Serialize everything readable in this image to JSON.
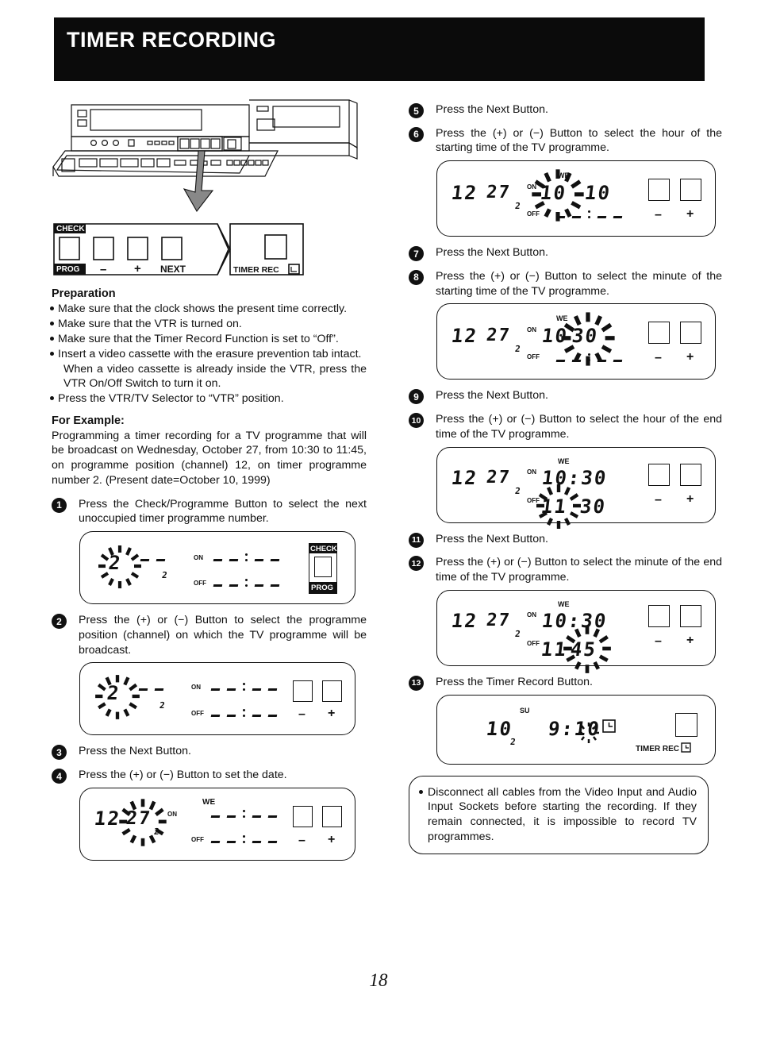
{
  "header": {
    "title": "TIMER RECORDING"
  },
  "page_number": "18",
  "illustration": {
    "name": "vtr-front-panel-drawing",
    "callout": {
      "check_label": "CHECK",
      "prog_label": "PROG",
      "minus_label": "–",
      "plus_label": "+",
      "next_label": "NEXT",
      "timer_rec_label": "TIMER REC"
    }
  },
  "preparation": {
    "heading": "Preparation",
    "items": [
      "Make sure that the clock shows the present time correctly.",
      "Make sure that the VTR is turned on.",
      "Make sure that the Timer Record Function is set to “Off”.",
      "Insert a video cassette with the erasure prevention tab intact.",
      "Press the VTR/TV Selector to “VTR” position."
    ],
    "continuation": "When a video cassette is already inside the VTR, press the VTR On/Off Switch to turn it on."
  },
  "for_example": {
    "heading": "For Example:",
    "text": "Programming a timer recording for a TV programme that will be broadcast on Wednesday, October 27, from 10:30 to 11:45, on programme position (channel) 12, on timer programme number 2. (Present date=October 10, 1999)"
  },
  "steps": [
    {
      "num": "1",
      "text": "Press the Check/Programme Button to select the next unoccupied timer programme number."
    },
    {
      "num": "2",
      "text": "Press the (+) or (−) Button to select the programme position (channel) on which the TV programme will be broadcast."
    },
    {
      "num": "3",
      "text": "Press the Next Button."
    },
    {
      "num": "4",
      "text": "Press the (+) or (−) Button to set the date."
    },
    {
      "num": "5",
      "text": "Press the Next Button."
    },
    {
      "num": "6",
      "text": "Press the (+) or (−) Button to select the hour of the starting time of the TV programme."
    },
    {
      "num": "7",
      "text": "Press the Next Button."
    },
    {
      "num": "8",
      "text": "Press the (+) or (−) Button to select the minute of the starting time of the TV programme."
    },
    {
      "num": "9",
      "text": "Press the Next Button."
    },
    {
      "num": "10",
      "text": "Press the (+) or (−) Button to select the hour of the end time of the TV programme."
    },
    {
      "num": "11",
      "text": "Press the Next Button."
    },
    {
      "num": "12",
      "text": "Press the (+) or (−) Button to select the minute of the end time of the TV programme."
    },
    {
      "num": "13",
      "text": "Press the Timer Record Button."
    }
  ],
  "displays": {
    "d1": {
      "channel": "2",
      "channel_blinking": true,
      "prog_number": "2",
      "on_label": "ON",
      "off_label": "OFF",
      "on_time": "--:--",
      "off_time": "--:--",
      "weekday": "",
      "check_label": "CHECK",
      "prog_label": "PROG"
    },
    "d2": {
      "channel": "2",
      "channel_blinking": true,
      "prog_number": "2",
      "on_label": "ON",
      "off_label": "OFF",
      "on_time": "--:--",
      "off_time": "--:--",
      "minus_label": "–",
      "plus_label": "+"
    },
    "d4": {
      "channel": "12",
      "date": "27",
      "date_blinking": true,
      "prog_number": "2",
      "weekday": "WE",
      "on_label": "ON",
      "off_label": "OFF",
      "on_time": "--:--",
      "off_time": "--:--",
      "minus_label": "–",
      "plus_label": "+"
    },
    "d6": {
      "channel": "12",
      "date": "27",
      "prog_number": "2",
      "weekday": "WE",
      "on_label": "ON",
      "off_label": "OFF",
      "on_hour": "10",
      "on_hour_blinking": true,
      "on_minute": "10",
      "off_time": "--:--",
      "minus_label": "–",
      "plus_label": "+"
    },
    "d8": {
      "channel": "12",
      "date": "27",
      "prog_number": "2",
      "weekday": "WE",
      "on_label": "ON",
      "off_label": "OFF",
      "on_hour": "10",
      "on_minute": "30",
      "on_minute_blinking": true,
      "off_time": "--:--",
      "minus_label": "–",
      "plus_label": "+"
    },
    "d10": {
      "channel": "12",
      "date": "27",
      "prog_number": "2",
      "weekday": "WE",
      "on_label": "ON",
      "off_label": "OFF",
      "on_time": "10:30",
      "off_hour": "11",
      "off_hour_blinking": true,
      "off_minute": "30",
      "minus_label": "–",
      "plus_label": "+"
    },
    "d12": {
      "channel": "12",
      "date": "27",
      "prog_number": "2",
      "weekday": "WE",
      "on_label": "ON",
      "off_label": "OFF",
      "on_time": "10:30",
      "off_hour": "11",
      "off_minute": "45",
      "off_minute_blinking": true,
      "minus_label": "–",
      "plus_label": "+"
    },
    "d13": {
      "date": "10",
      "prog_number": "2",
      "weekday": "SU",
      "clock_time": "9:10",
      "timer_rec_label": "TIMER REC"
    }
  },
  "warning": {
    "text": "Disconnect all cables from the Video Input and Audio Input Sockets before starting the recording. If they remain connected, it is impossible to record TV programmes."
  }
}
